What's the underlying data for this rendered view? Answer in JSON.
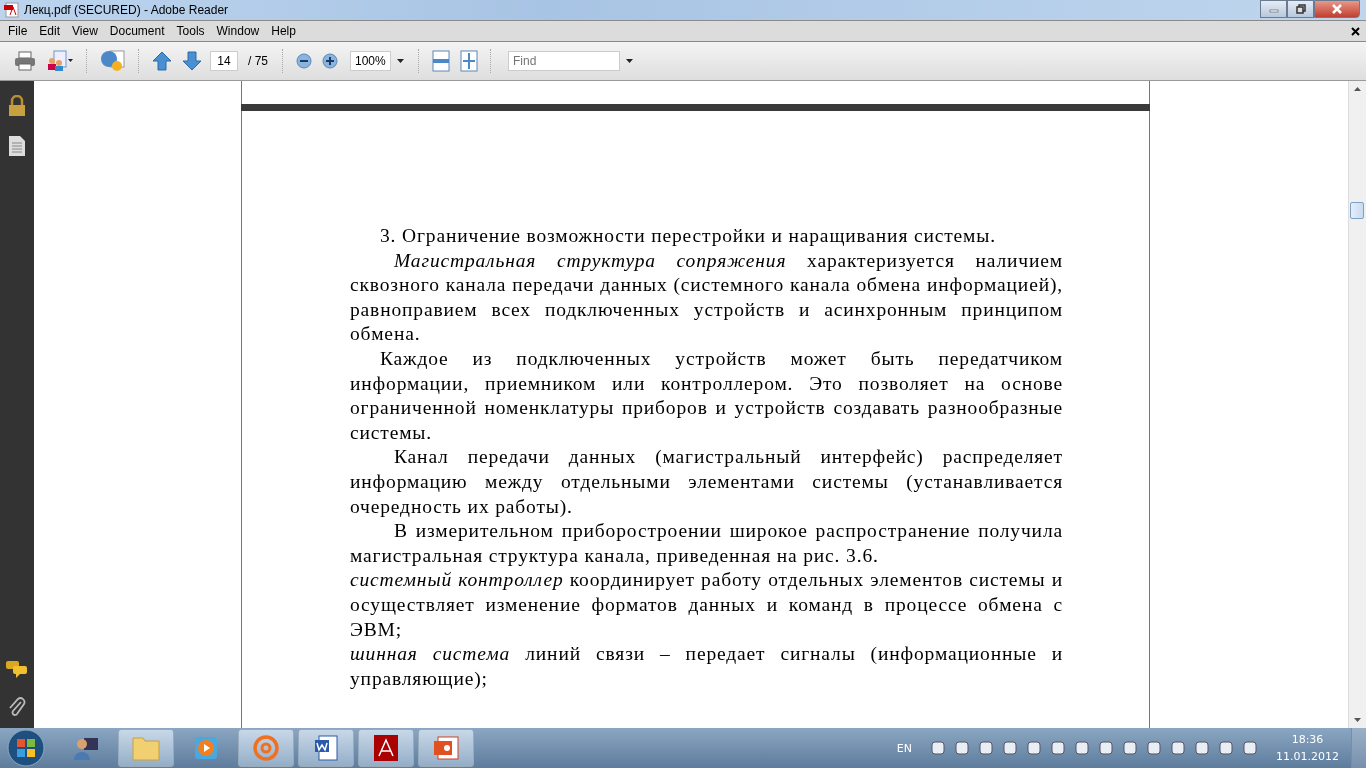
{
  "window": {
    "title": "Лекц.pdf (SECURED) - Adobe Reader"
  },
  "menu": [
    "File",
    "Edit",
    "View",
    "Document",
    "Tools",
    "Window",
    "Help"
  ],
  "toolbar": {
    "page_number": "14",
    "page_total": "/ 75",
    "zoom": "100%",
    "find_placeholder": "Find"
  },
  "document": {
    "paragraphs": [
      {
        "kind": "indent",
        "text": "3. Ограничение возможности перестройки и наращивания системы."
      },
      {
        "kind": "wide-indent",
        "text": "*Магистральная структура сопряжения* характеризуется наличием сквозного канала передачи данных (системного канала обмена информацией), равноправием всех подключенных устройств и асинхронным принципом обмена."
      },
      {
        "kind": "indent",
        "text": "Каждое из подключенных устройств может быть передатчиком информации, приемником или контроллером. Это позволяет на основе ограниченной номенклатуры приборов и устройств создавать разнообразные системы."
      },
      {
        "kind": "wide-indent",
        "text": "Канал передачи данных (магистральный интерфейс) распределяет информацию между отдельными элементами системы (устанавливается очередность их работы)."
      },
      {
        "kind": "wide-indent",
        "text": "В измерительном приборостроении широкое распространение получила магистральная структура канала, приведенная на рис. 3.6."
      },
      {
        "kind": "flush",
        "text": "*системный контроллер* координирует работу отдельных элементов системы и осуществляет изменение форматов данных и команд в процессе обмена с ЭВМ;"
      },
      {
        "kind": "flush",
        "text": "*шинная система* линий связи – передает сигналы (информационные и управляющие);"
      }
    ]
  },
  "taskbar": {
    "language": "EN",
    "time": "18:36",
    "date": "11.01.2012"
  }
}
